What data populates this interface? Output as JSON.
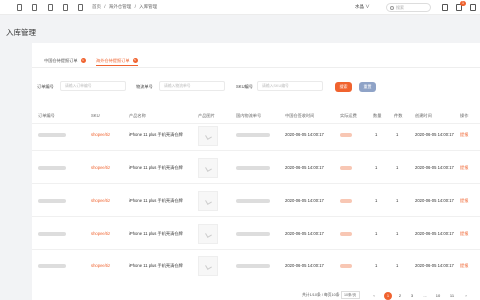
{
  "topbar": {
    "breadcrumb": [
      "首页",
      "/",
      "海外仓管理",
      "/",
      "入库管理"
    ],
    "store_label": "水晶 ∨",
    "search_placeholder": "搜索",
    "bell_badge": "1"
  },
  "page": {
    "title": "入库管理"
  },
  "tabs": [
    {
      "label": "中国仓待提报订单",
      "badge": "1"
    },
    {
      "label": "海外仓待提报订单",
      "badge": "5"
    }
  ],
  "filters": {
    "order_label": "订单编号",
    "order_placeholder": "请输入订单编号",
    "product_label": "物流单号",
    "product_placeholder": "请输入物流单号",
    "sku_label": "SKU编号",
    "sku_placeholder": "请输入SKU编号",
    "search_button": "搜索",
    "reset_button": "重置"
  },
  "table": {
    "columns": [
      "订单编号",
      "SKU",
      "产品名称",
      "产品图片",
      "国内物流单号",
      "中国仓签收时间",
      "实际运费",
      "数量",
      "件数",
      "创建时间",
      "操作"
    ],
    "rows": [
      {
        "shop": "shopee/tiz",
        "product": "iPhone 11 plus 手机壳清仓牌",
        "signed": "2020-06-05 14:00:17",
        "qty": "1",
        "pcs": "1",
        "created": "2020-06-05 14:00:17",
        "action": "提报"
      },
      {
        "shop": "shopee/tiz",
        "product": "iPhone 11 plus 手机壳清仓牌",
        "signed": "2020-06-05 14:00:17",
        "qty": "1",
        "pcs": "1",
        "created": "2020-06-05 14:00:17",
        "action": "提报"
      },
      {
        "shop": "shopee/tiz",
        "product": "iPhone 11 plus 手机壳清仓牌",
        "signed": "2020-06-05 14:00:17",
        "qty": "1",
        "pcs": "1",
        "created": "2020-06-05 14:00:17",
        "action": "提报"
      },
      {
        "shop": "shopee/tiz",
        "product": "iPhone 11 plus 手机壳清仓牌",
        "signed": "2020-06-05 14:00:17",
        "qty": "1",
        "pcs": "1",
        "created": "2020-06-05 14:00:17",
        "action": "提报"
      },
      {
        "shop": "shopee/tiz",
        "product": "iPhone 11 plus 手机壳清仓牌",
        "signed": "2020-06-05 14:00:17",
        "qty": "1",
        "pcs": "1",
        "created": "2020-06-05 14:00:17",
        "action": "提报"
      }
    ]
  },
  "pagination": {
    "total": "共计1/10条 / 每页10条",
    "page_size": "10条/页",
    "pages": [
      "‹",
      "1",
      "2",
      "3",
      "...",
      "10",
      "11",
      "›"
    ],
    "current": "1"
  },
  "colors": {
    "accent": "#f0632f",
    "reset": "#8fa3c7"
  }
}
